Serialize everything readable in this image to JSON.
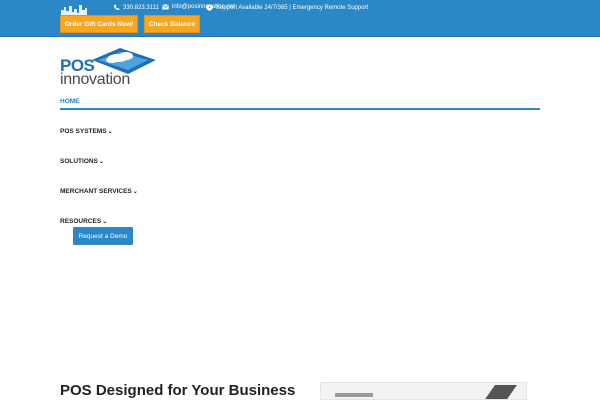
{
  "topbar": {
    "phone": "330.823.3111",
    "email": "info@posinnovation.net",
    "support": "Support Available 24/7/365 |  Emergency Remote Support",
    "buttons": {
      "gift_cards": "Order Gift Cards Now!",
      "check_balance": "Check Balance"
    },
    "icons": [
      "skyline-icon",
      "phone-icon",
      "mail-icon",
      "clock-icon"
    ],
    "colors": {
      "bar": "#2b87c5",
      "button": "#f5a623"
    }
  },
  "logo": {
    "line1": "POS",
    "line2": "innovation"
  },
  "nav": {
    "home": "HOME",
    "items": [
      "POS SYSTEMS",
      "SOLUTIONS",
      "MERCHANT SERVICES",
      "RESOURCES"
    ],
    "chevron": "⌄"
  },
  "cta": {
    "demo": "Request a Demo"
  },
  "main": {
    "headline": "POS Designed for Your Business"
  }
}
